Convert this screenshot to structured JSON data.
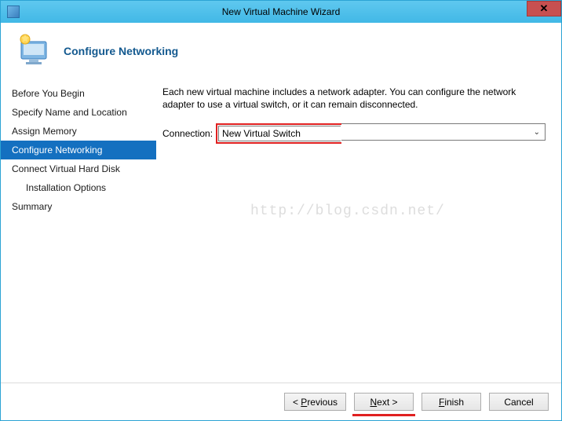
{
  "title": "New Virtual Machine Wizard",
  "header": {
    "title": "Configure Networking"
  },
  "sidebar": {
    "steps": [
      {
        "label": "Before You Begin",
        "active": false,
        "indent": false
      },
      {
        "label": "Specify Name and Location",
        "active": false,
        "indent": false
      },
      {
        "label": "Assign Memory",
        "active": false,
        "indent": false
      },
      {
        "label": "Configure Networking",
        "active": true,
        "indent": false
      },
      {
        "label": "Connect Virtual Hard Disk",
        "active": false,
        "indent": false
      },
      {
        "label": "Installation Options",
        "active": false,
        "indent": true
      },
      {
        "label": "Summary",
        "active": false,
        "indent": false
      }
    ]
  },
  "content": {
    "description": "Each new virtual machine includes a network adapter. You can configure the network adapter to use a virtual switch, or it can remain disconnected.",
    "connection_label": "Connection:",
    "connection_value": "New Virtual Switch"
  },
  "watermark": "http://blog.csdn.net/",
  "footer": {
    "previous_prefix": "< ",
    "previous_u": "P",
    "previous_suffix": "revious",
    "next_u": "N",
    "next_suffix": "ext >",
    "finish_u": "F",
    "finish_suffix": "inish",
    "cancel": "Cancel"
  }
}
